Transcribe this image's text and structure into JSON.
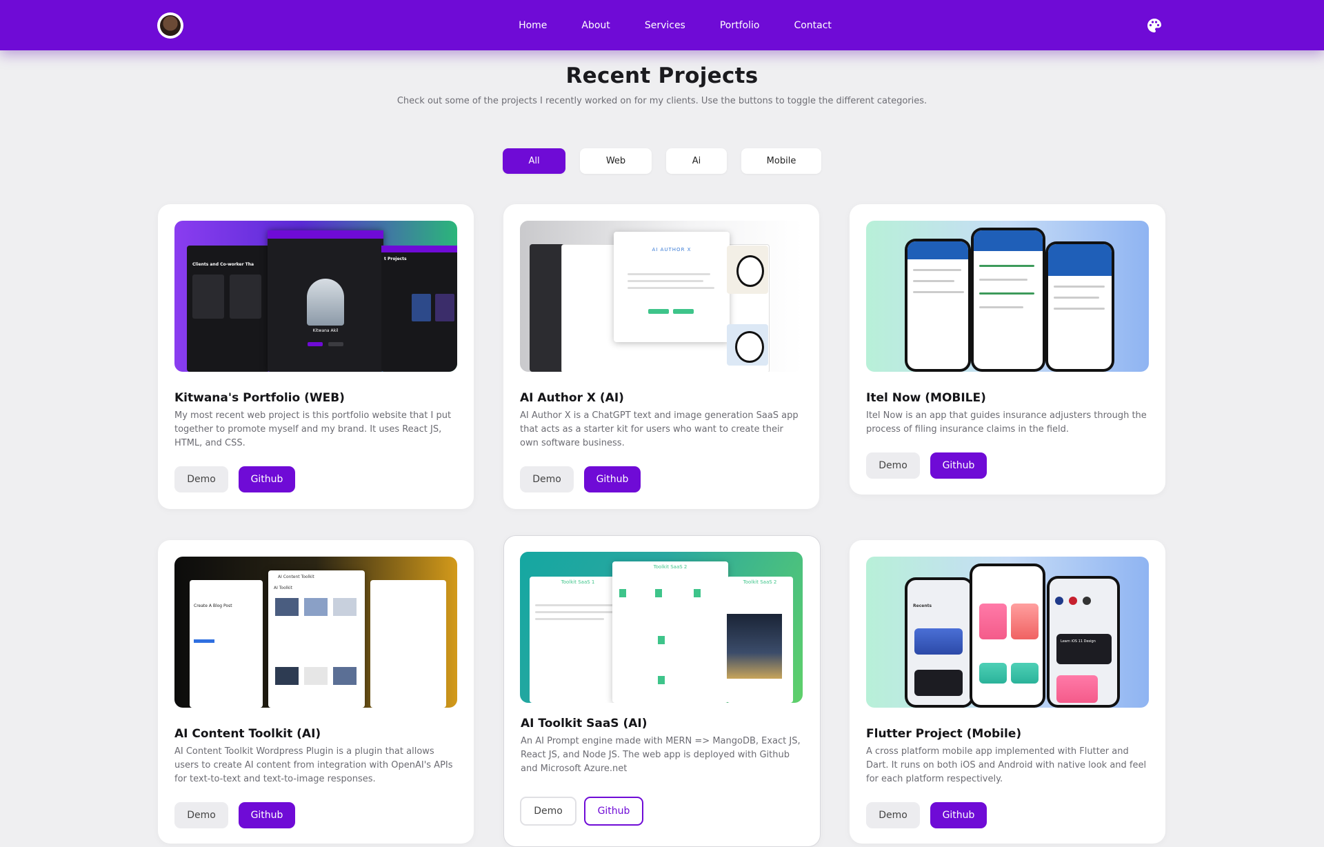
{
  "nav": {
    "links": [
      "Home",
      "About",
      "Services",
      "Portfolio",
      "Contact"
    ]
  },
  "header": {
    "title": "Recent Projects",
    "subtitle": "Check out some of the projects I recently worked on for my clients. Use the buttons to toggle the different categories."
  },
  "filters": {
    "items": [
      "All",
      "Web",
      "Ai",
      "Mobile"
    ],
    "active": "All"
  },
  "projects": [
    {
      "title": "Kitwana's Portfolio (WEB)",
      "description": "My most recent web project is this portfolio website that I put together to promote myself and my brand. It uses React JS, HTML, and CSS.",
      "demo": "Demo",
      "github": "Github",
      "thumb_label_1": "Clients and Co-worker Tha",
      "thumb_label_2": "Kitwana Akil",
      "thumb_label_3": "t Projects"
    },
    {
      "title": "AI Author X (AI)",
      "description": "AI Author X is a ChatGPT text and image generation SaaS app that acts as a starter kit for users who want to create their own software business.",
      "demo": "Demo",
      "github": "Github",
      "thumb_label_1": "AI AUTHOR X"
    },
    {
      "title": "Itel Now (MOBILE)",
      "description": "Itel Now is an app that guides insurance adjusters through the process of filing insurance claims in the field.",
      "demo": "Demo",
      "github": "Github"
    },
    {
      "title": "AI Content Toolkit (AI)",
      "description": "AI Content Toolkit Wordpress Plugin is a plugin that allows users to create AI content from integration with OpenAI's APIs for text-to-text and text-to-image responses.",
      "demo": "Demo",
      "github": "Github",
      "thumb_label_1": "AI Content Toolkit",
      "thumb_label_2": "Create A Blog Post",
      "thumb_label_3": "AI Toolkit"
    },
    {
      "title": "AI Toolkit SaaS (AI)",
      "description": "An AI Prompt engine made with MERN => MangoDB, Exact JS, React JS, and Node JS. The web app is deployed with Github and Microsoft Azure.net",
      "demo": "Demo",
      "github": "Github",
      "thumb_label_1": "Toolkit SaaS 2",
      "thumb_label_2": "Toolkit SaaS 1",
      "thumb_label_3": "Toolkit SaaS 2"
    },
    {
      "title": "Flutter Project (Mobile)",
      "description": "A cross platform mobile app implemented with Flutter and Dart. It runs on both iOS and Android with native look and feel for each platform respectively.",
      "demo": "Demo",
      "github": "Github",
      "thumb_label_1": "Recents",
      "thumb_label_2": "Learn iOS 11 Design"
    }
  ],
  "colors": {
    "primary": "#6f0bd6",
    "background": "#efeff1",
    "card": "#ffffff"
  },
  "icons": {
    "avatar": "profile-avatar",
    "theme": "palette-icon"
  }
}
